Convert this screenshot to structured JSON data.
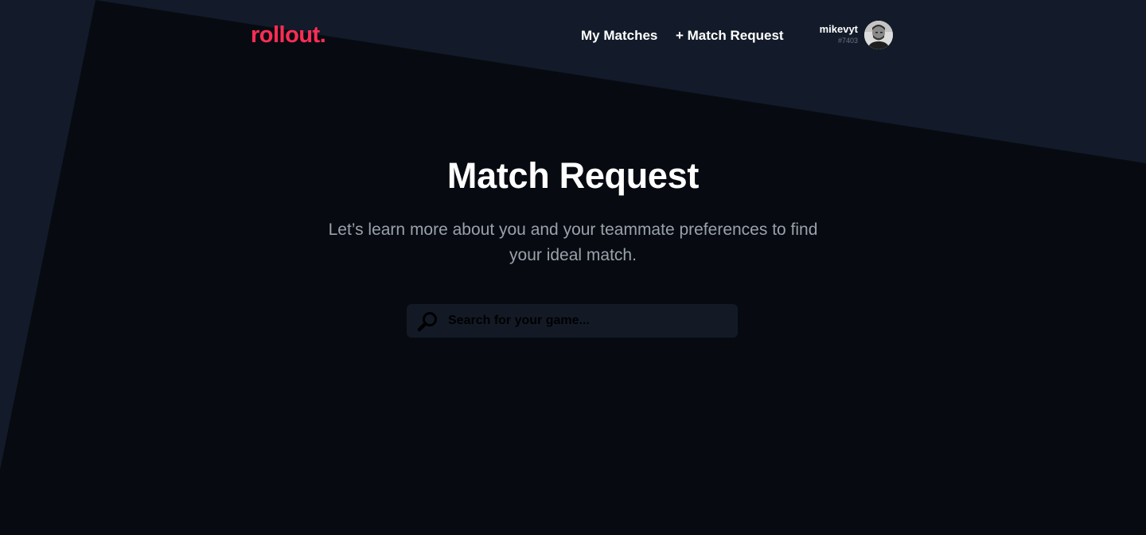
{
  "header": {
    "logo": "rollout.",
    "nav": {
      "my_matches": "My Matches",
      "match_request": "+ Match Request"
    },
    "user": {
      "name": "mikevyt",
      "tag": "#7403",
      "avatar_icon": "user-avatar-icon"
    }
  },
  "main": {
    "title": "Match Request",
    "subtitle": "Let’s learn more about you and your teammate preferences to find your ideal match.",
    "search": {
      "icon": "search-icon",
      "value": "",
      "placeholder": "Search for your game..."
    }
  },
  "colors": {
    "background": "#070b11",
    "panel": "#131b2a",
    "brand": "#ff2d55",
    "text": "#ffffff",
    "muted_text": "#9aa1ab"
  }
}
